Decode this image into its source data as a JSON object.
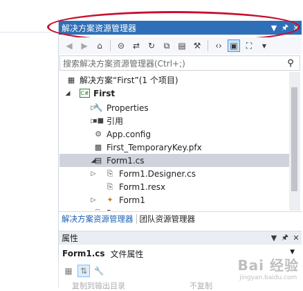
{
  "solution_explorer": {
    "title": "解决方案资源管理器",
    "title_buttons": [
      "▼",
      "🖈",
      "✕"
    ],
    "search_placeholder": "搜索解决方案资源管理器(Ctrl+;)",
    "tree": [
      {
        "label": "解决方案“First”(1 个项目)",
        "icon": "solution-icon",
        "expander": ""
      },
      {
        "label": "First",
        "icon": "csharp-project-icon",
        "expander": "◢",
        "bold": true
      },
      {
        "label": "Properties",
        "icon": "wrench-icon",
        "expander": "▷"
      },
      {
        "label": "引用",
        "icon": "references-icon",
        "expander": "▷"
      },
      {
        "label": "App.config",
        "icon": "config-file-icon",
        "expander": ""
      },
      {
        "label": "First_TemporaryKey.pfx",
        "icon": "certificate-icon",
        "expander": ""
      },
      {
        "label": "Form1.cs",
        "icon": "form-icon",
        "expander": "◢",
        "selected": true
      },
      {
        "label": "Form1.Designer.cs",
        "icon": "csharp-file-icon",
        "expander": "▷"
      },
      {
        "label": "Form1.resx",
        "icon": "resx-file-icon",
        "expander": ""
      },
      {
        "label": "Form1",
        "icon": "class-icon",
        "expander": "▷"
      },
      {
        "label": "P",
        "icon": "csharp-file-icon",
        "expander": "▷"
      }
    ]
  },
  "bottom_tabs": [
    {
      "label": "解决方案资源管理器",
      "active": true
    },
    {
      "label": "团队资源管理器",
      "active": false
    }
  ],
  "properties": {
    "title": "属性",
    "object_name": "Form1.cs",
    "object_type": "文件属性",
    "row_key": "复制到输出目录",
    "row_value": "不复制"
  },
  "watermark": {
    "main": "Bai 经验",
    "sub": "jingyan.baidu.com"
  },
  "colors": {
    "titlebar": "#2f6fb7",
    "highlight_ring": "#c8102e",
    "selection": "#cfd3db"
  }
}
